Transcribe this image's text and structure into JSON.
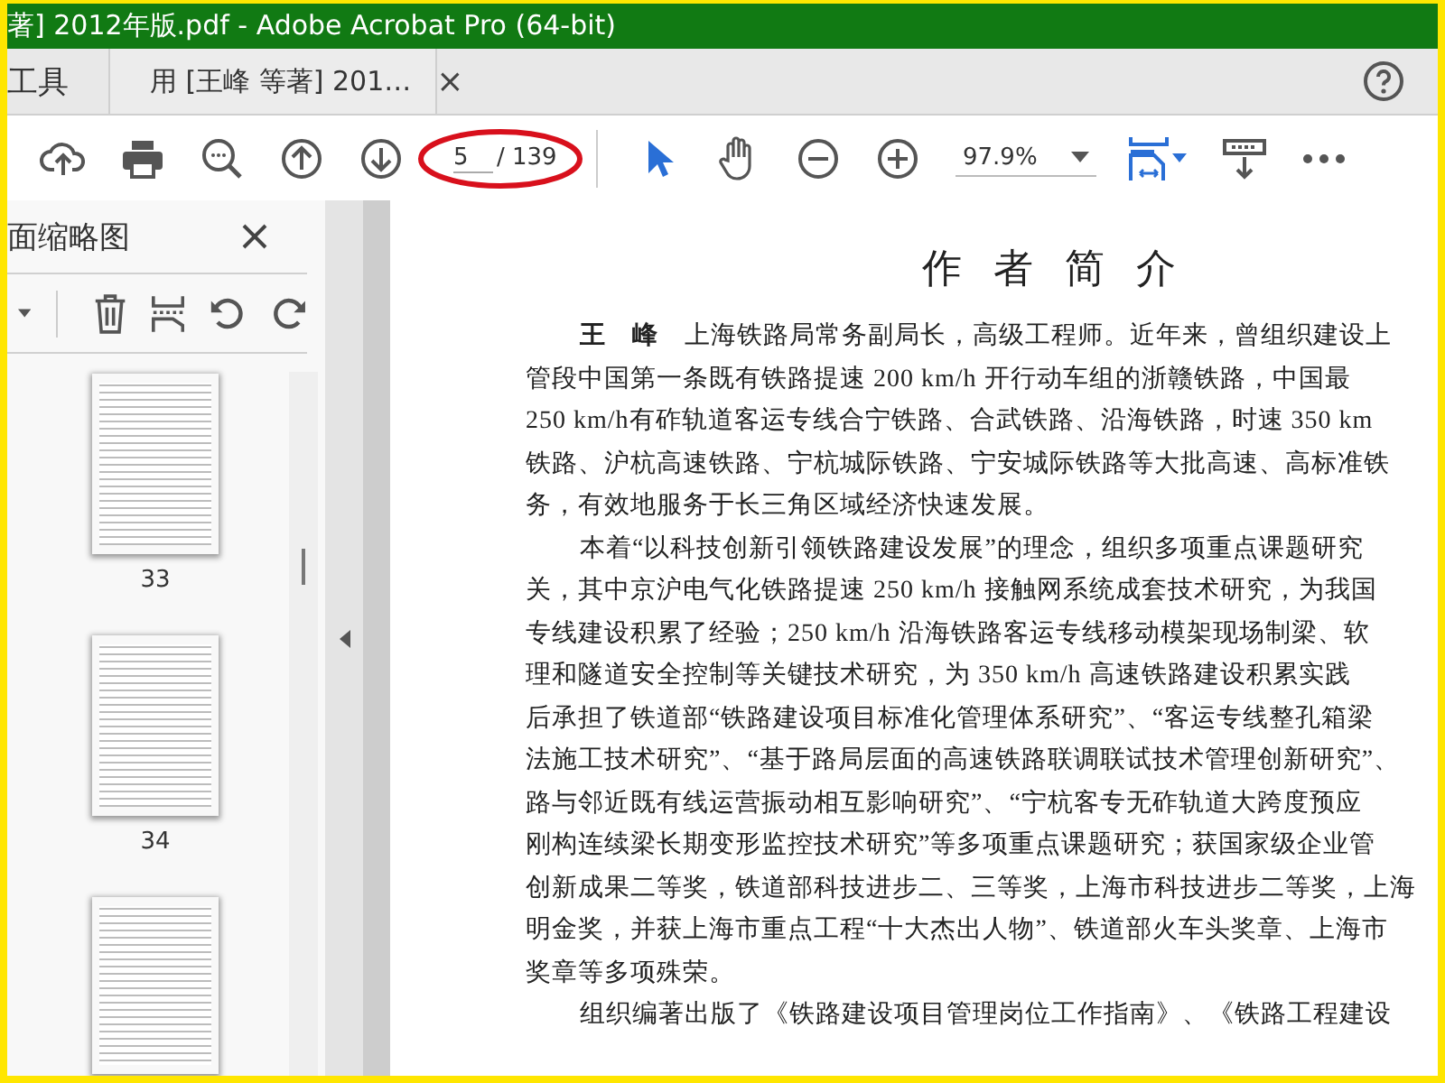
{
  "window": {
    "title": "著] 2012年版.pdf - Adobe Acrobat Pro (64-bit)"
  },
  "tabs": [
    {
      "label": "工具",
      "selected": false
    },
    {
      "label": "用 [王峰 等著] 201…",
      "selected": true,
      "close": "×"
    }
  ],
  "toolbar": {
    "page": "5",
    "total": "/ 139",
    "zoom": "97.9%",
    "tools": [
      {
        "kind": "select",
        "selected": true
      },
      {
        "kind": "hand",
        "selected": false
      }
    ]
  },
  "sidebar": {
    "title": "面缩略图",
    "thumbnails": [
      "33",
      "34"
    ],
    "partial_thumbnail": true
  },
  "document": {
    "title": "作 者 简 介",
    "lines": [
      {
        "text": "**王　峰**　上海铁路局常务副局长，高级工程师。近年来，曾组织建设上",
        "indent": true
      },
      {
        "text": "管段中国第一条既有铁路提速 200 km/h 开行动车组的浙赣铁路，中国最",
        "indent": false
      },
      {
        "text": "250 km/h有砟轨道客运专线合宁铁路、合武铁路、沿海铁路，时速 350 km",
        "indent": false
      },
      {
        "text": "铁路、沪杭高速铁路、宁杭城际铁路、宁安城际铁路等大批高速、高标准铁",
        "indent": false
      },
      {
        "text": "务，有效地服务于长三角区域经济快速发展。",
        "indent": false
      },
      {
        "text": "本着“以科技创新引领铁路建设发展”的理念，组织多项重点课题研究",
        "indent": true
      },
      {
        "text": "关，其中京沪电气化铁路提速 250 km/h 接触网系统成套技术研究，为我国",
        "indent": false
      },
      {
        "text": "专线建设积累了经验；250 km/h 沿海铁路客运专线移动模架现场制梁、软",
        "indent": false
      },
      {
        "text": "理和隧道安全控制等关键技术研究，为 350 km/h 高速铁路建设积累实践",
        "indent": false
      },
      {
        "text": "后承担了铁道部“铁路建设项目标准化管理体系研究”、“客运专线整孔箱梁",
        "indent": false
      },
      {
        "text": "法施工技术研究”、“基于路局层面的高速铁路联调联试技术管理创新研究”、",
        "indent": false
      },
      {
        "text": "路与邻近既有线运营振动相互影响研究”、“宁杭客专无砟轨道大跨度预应",
        "indent": false
      },
      {
        "text": "刚构连续梁长期变形监控技术研究”等多项重点课题研究；获国家级企业管",
        "indent": false
      },
      {
        "text": "创新成果二等奖，铁道部科技进步二、三等奖，上海市科技进步二等奖，上海",
        "indent": false
      },
      {
        "text": "明金奖，并获上海市重点工程“十大杰出人物”、铁道部火车头奖章、上海市",
        "indent": false
      },
      {
        "text": "奖章等多项殊荣。",
        "indent": false
      },
      {
        "text": "组织编著出版了《铁路建设项目管理岗位工作指南》、《铁路工程建设",
        "indent": true
      }
    ]
  }
}
